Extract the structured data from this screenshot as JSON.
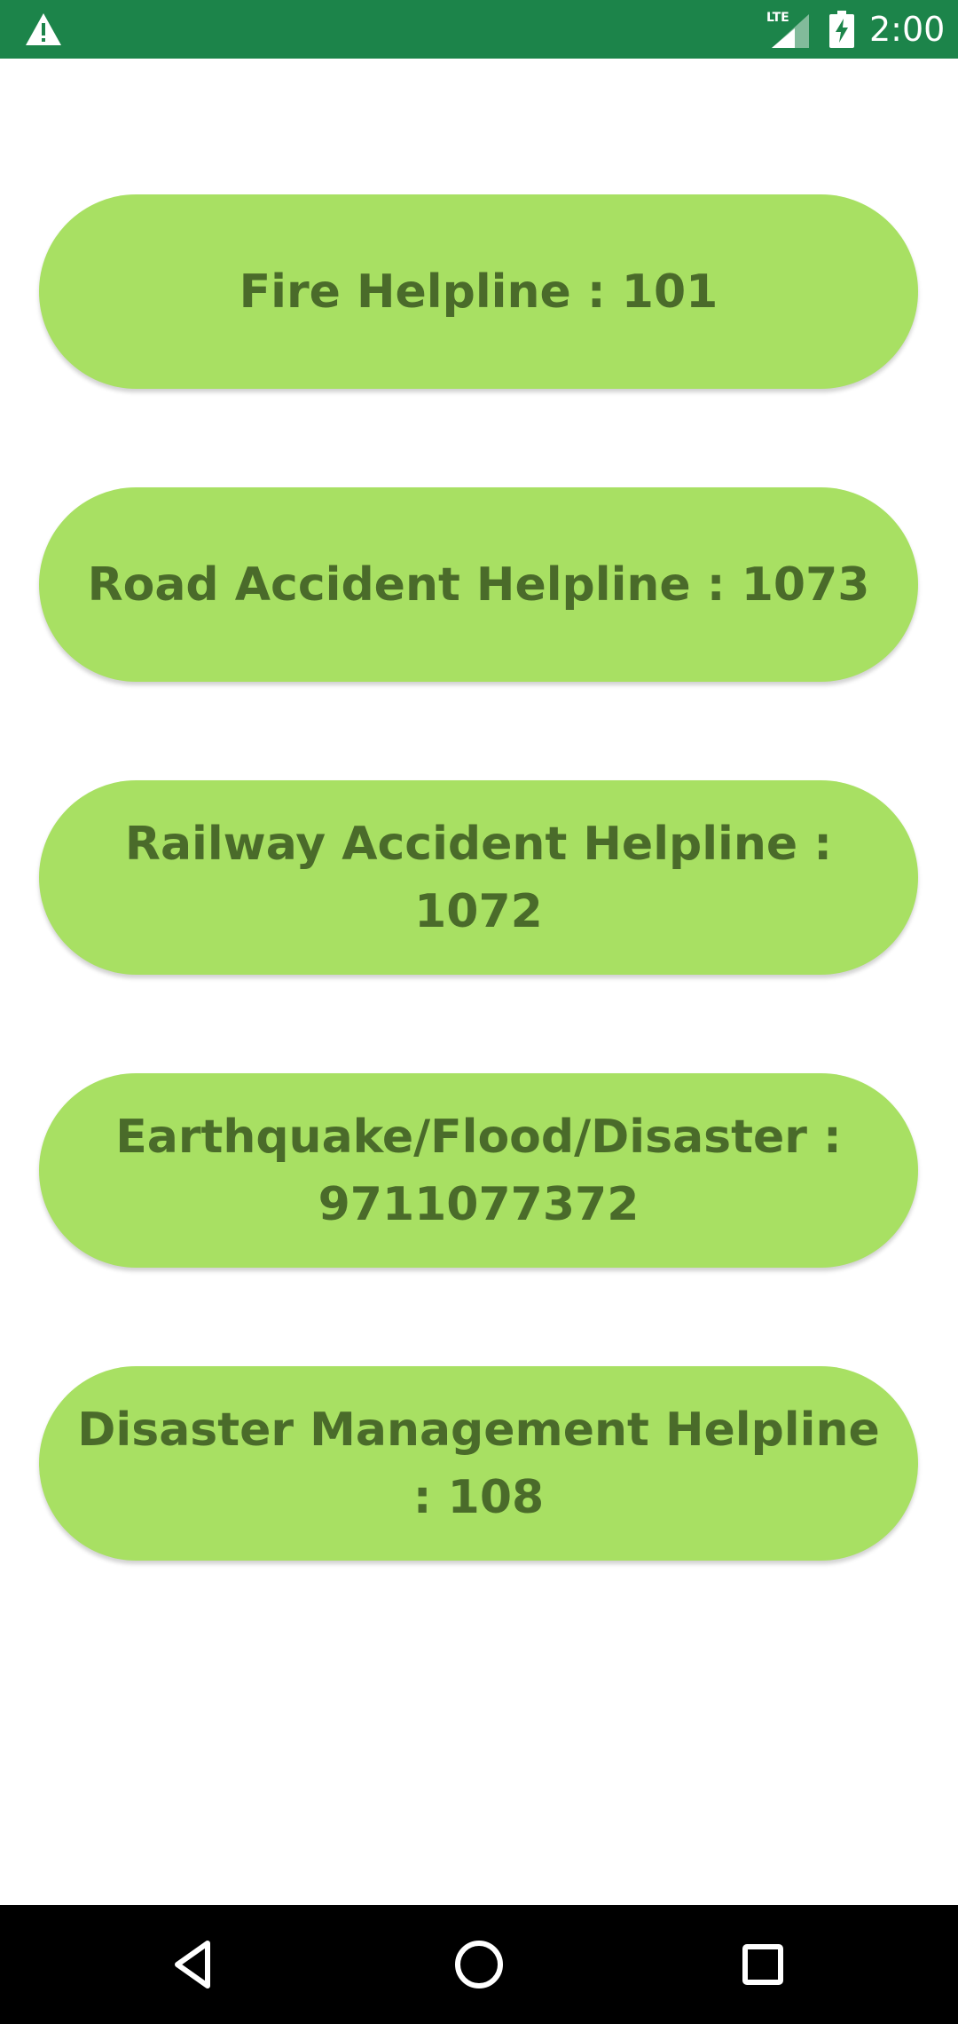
{
  "status_bar": {
    "time": "2:00",
    "network": "LTE",
    "icons": [
      "alert-icon",
      "lte-signal-icon",
      "battery-charging-icon"
    ],
    "color": "#1c844a"
  },
  "helplines": [
    {
      "label": "Fire Helpline : 101"
    },
    {
      "label": "Road Accident Helpline : 1073"
    },
    {
      "label": "Railway Accident Helpline : 1072"
    },
    {
      "label": "Earthquake/Flood/Disaster : 9711077372"
    },
    {
      "label": "Disaster Management Helpline : 108"
    }
  ],
  "button_style": {
    "background": "#a8e063",
    "text_color": "#4a6b2a"
  },
  "nav_bar": {
    "icons": [
      "back-icon",
      "home-icon",
      "recents-icon"
    ]
  }
}
